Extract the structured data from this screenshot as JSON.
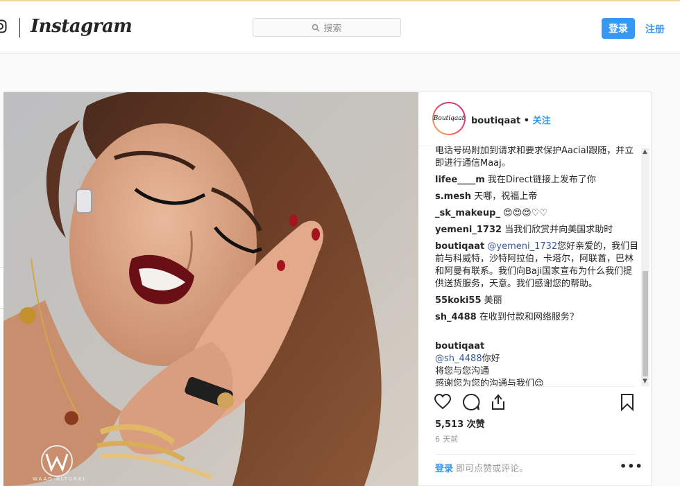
{
  "header": {
    "brand": "Instagram",
    "search_placeholder": "搜索",
    "login_button": "登录",
    "signup_link": "注册"
  },
  "post": {
    "watermark": "WAAD ALTURKI",
    "avatar_text": "Boutiqaat",
    "username": "boutiqaat",
    "separator": "•",
    "follow": "关注",
    "comments": [
      {
        "user": "",
        "mention": "",
        "text": "电话号码附加到请求和要求保护Aacial跟随，并立即进行通信Maaj。"
      },
      {
        "user": "lifee____m",
        "mention": "",
        "text": "我在Direct链接上发布了你"
      },
      {
        "user": "s.mesh",
        "mention": "",
        "text": "天哪，祝福上帝"
      },
      {
        "user": "_sk_makeup_",
        "mention": "",
        "text": "😍😍😍♡♡"
      },
      {
        "user": "yemeni_1732",
        "mention": "",
        "text": "当我们欣赏并向美国求助时"
      },
      {
        "user": "boutiqaat",
        "mention": "@yemeni_1732",
        "text": "您好亲爱的，我们目前与科威特，沙特阿拉伯，卡塔尔，阿联酋，巴林和阿曼有联系。我们向Baji国家宣布为什么我们提供送货服务，天意。我们感谢您的帮助。"
      },
      {
        "user": "55koki55",
        "mention": "",
        "text": "美丽"
      },
      {
        "user": "sh_4488",
        "mention": "",
        "text": "在收到付款和网络服务？"
      },
      {
        "user": "boutiqaat",
        "mention": "@sh_4488",
        "text": "你好\n将您与您沟通\n感谢您为您的沟通与我们😌"
      }
    ],
    "likes": "5,513 次赞",
    "time": "6 天前",
    "login_prompt_link": "登录",
    "login_prompt_text": " 即可点赞或评论。",
    "more": "•••"
  },
  "colors": {
    "accent": "#3897f0",
    "border": "#dbdbdb",
    "background": "#fafafa"
  }
}
